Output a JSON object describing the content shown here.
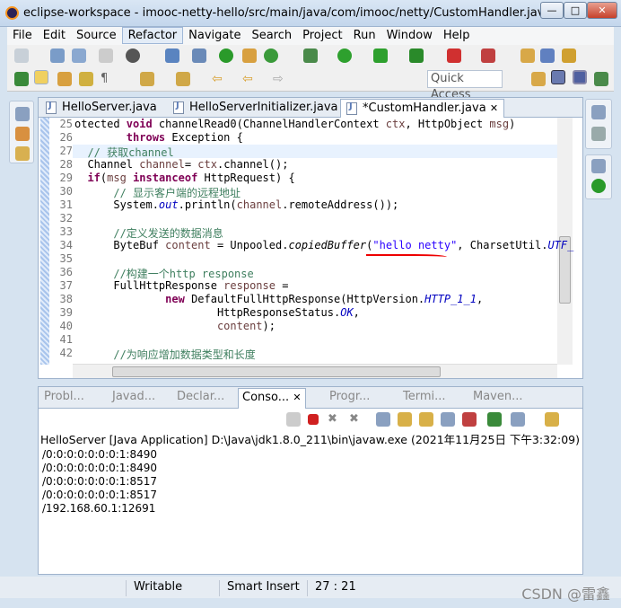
{
  "window": {
    "title": "eclipse-workspace - imooc-netty-hello/src/main/java/com/imooc/netty/CustomHandler.java -...",
    "min": "—",
    "max": "□",
    "close": "✕"
  },
  "menu": [
    "File",
    "Edit",
    "Source",
    "Refactor",
    "Navigate",
    "Search",
    "Project",
    "Run",
    "Window",
    "Help"
  ],
  "toolbar": {
    "quick_access": "Quick Access"
  },
  "editor": {
    "tabs": [
      {
        "label": "HelloServer.java"
      },
      {
        "label": "HelloServerInitializer.java"
      },
      {
        "label": "*CustomHandler.java",
        "close": "✕"
      }
    ],
    "lines": [
      {
        "n": "25",
        "html": "otected <span class='kw'>void</span> channelRead0(ChannelHandlerContext <span class='va'>ctx</span>, HttpObject <span class='va'>msg</span>)"
      },
      {
        "n": "26",
        "html": "        <span class='kw'>throws</span> Exception {"
      },
      {
        "n": "27",
        "html": "  <span class='cm'>// 获取channel</span>"
      },
      {
        "n": "28",
        "html": "  Channel <span class='va'>channel</span>= <span class='va'>ctx</span>.channel();"
      },
      {
        "n": "29",
        "html": "  <span class='kw'>if</span>(<span class='va'>msg</span> <span class='kw'>instanceof</span> HttpRequest) {"
      },
      {
        "n": "30",
        "html": "      <span class='cm'>// 显示客户端的远程地址</span>"
      },
      {
        "n": "31",
        "html": "      System.<span class='fi'>out</span>.println(<span class='va'>channel</span>.remoteAddress());"
      },
      {
        "n": "32",
        "html": ""
      },
      {
        "n": "33",
        "html": "      <span class='cm'>//定义发送的数据消息</span>"
      },
      {
        "n": "34",
        "html": "      ByteBuf <span class='va'>content</span> = Unpooled.<span class='it'>copiedBuffer</span>(<span class='st'>\"hello netty\"</span>, CharsetUtil.<span class='fi'>UTF_</span>"
      },
      {
        "n": "35",
        "html": ""
      },
      {
        "n": "36",
        "html": "      <span class='cm'>//构建一个http response</span>"
      },
      {
        "n": "37",
        "html": "      FullHttpResponse <span class='va'>response</span> ="
      },
      {
        "n": "38",
        "html": "              <span class='kw'>new</span> DefaultFullHttpResponse(HttpVersion.<span class='fi'>HTTP_1_1</span>,"
      },
      {
        "n": "39",
        "html": "                      HttpResponseStatus.<span class='fi'>OK</span>,"
      },
      {
        "n": "40",
        "html": "                      <span class='va'>content</span>);"
      },
      {
        "n": "41",
        "html": ""
      },
      {
        "n": "42",
        "html": "      <span class='cm'>//为响应增加数据类型和长度</span>"
      }
    ]
  },
  "panel": {
    "tabs": [
      "Probl...",
      "Javad...",
      "Declar...",
      "Conso...",
      "Progr...",
      "Termi...",
      "Maven..."
    ],
    "console_header": "HelloServer [Java Application] D:\\Java\\jdk1.8.0_211\\bin\\javaw.exe (2021年11月25日 下午3:32:09)",
    "output": [
      "/0:0:0:0:0:0:0:1:8490",
      "/0:0:0:0:0:0:0:1:8490",
      "/0:0:0:0:0:0:0:1:8517",
      "/0:0:0:0:0:0:0:1:8517",
      "/192.168.60.1:12691"
    ]
  },
  "status": {
    "mode": "Writable",
    "insert": "Smart Insert",
    "position": "27 : 21"
  },
  "watermark": "CSDN @雷鑫"
}
